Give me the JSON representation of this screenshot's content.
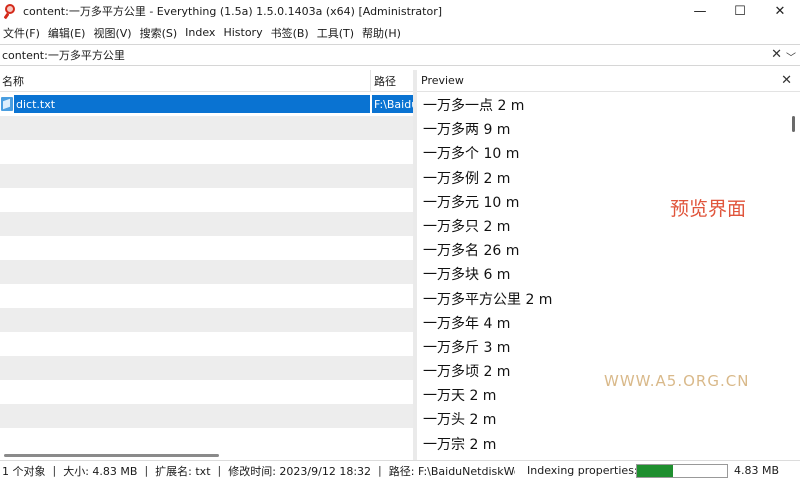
{
  "window": {
    "title": "content:一万多平方公里 - Everything (1.5a) 1.5.0.1403a (x64) [Administrator]",
    "minimize_glyph": "—",
    "maximize_glyph": "☐",
    "close_glyph": "✕"
  },
  "menu": {
    "items": [
      "文件(F)",
      "编辑(E)",
      "视图(V)",
      "搜索(S)",
      "Index",
      "History",
      "书签(B)",
      "工具(T)",
      "帮助(H)"
    ]
  },
  "search": {
    "value": "content:一万多平方公里",
    "clear_glyph": "✕",
    "dropdown_glyph": "﹀"
  },
  "results": {
    "columns": {
      "name": "名称",
      "path": "路径"
    },
    "selected": {
      "name": "dict.txt",
      "path": "F:\\BaiduNetdiskWor"
    },
    "row_count": 15
  },
  "preview": {
    "header": "Preview",
    "close_glyph": "✕",
    "lines": [
      "一万多一点 2 m",
      "一万多两 9 m",
      "一万多个 10 m",
      "一万多例 2 m",
      "一万多元 10 m",
      "一万多只 2 m",
      "一万多名 26 m",
      "一万多块 6 m",
      "一万多平方公里 2 m",
      "一万多年 4 m",
      "一万多斤 3 m",
      "一万多顷 2 m",
      "一万天 2 m",
      "一万头 2 m",
      "一万宗 2 m"
    ],
    "overlay_label": "预览界面",
    "watermark": "WWW.A5.ORG.CN"
  },
  "status": {
    "count": "1 个对象",
    "size": "大小: 4.83 MB",
    "ext": "扩展名: txt",
    "modified": "修改时间: 2023/9/12 18:32",
    "path": "路径: F:\\BaiduNetdiskWor",
    "indexing": "Indexing properties:",
    "indexing_progress": 0.4,
    "total_size": "4.83 MB",
    "separator": "|"
  },
  "colors": {
    "selection": "#0a73d2",
    "progress": "#1f8f2f",
    "overlay": "#e0553c"
  }
}
